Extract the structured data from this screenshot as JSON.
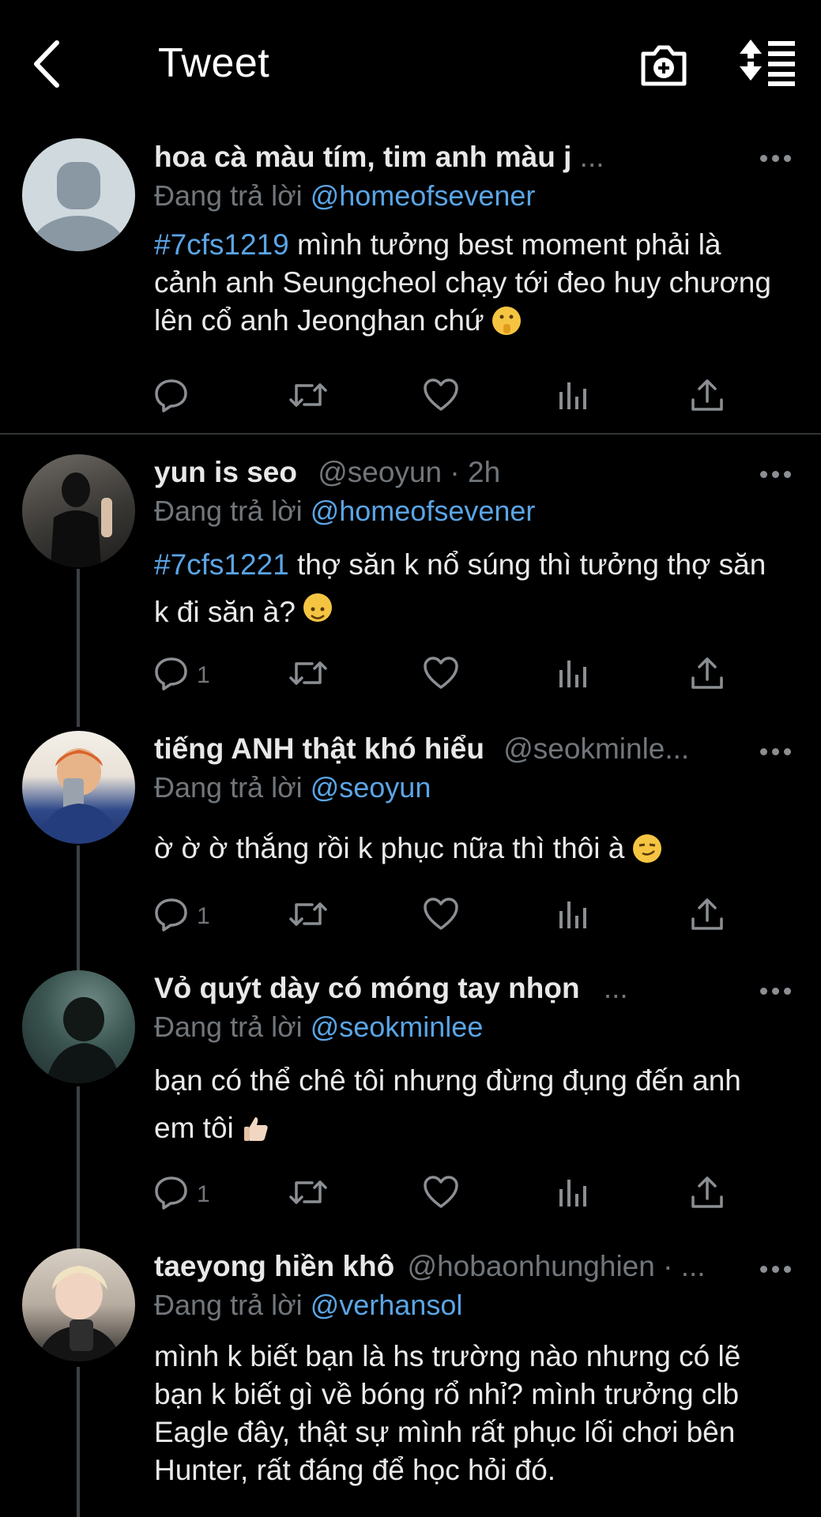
{
  "header": {
    "title": "Tweet"
  },
  "tweets": [
    {
      "name": "hoa cà màu tím, tim anh màu j",
      "handle": "",
      "ellipsis": "...",
      "reply_prefix": "Đang trả lời",
      "reply_to": "@homeofsevener",
      "hashtag": "#7cfs1219",
      "text": " mình tưởng best moment phải là cảnh anh Seungcheol chạy tới đeo huy chương lên cổ anh Jeonghan chứ",
      "emoji": "shushing-face",
      "reply_count": ""
    },
    {
      "name": "yun is seo",
      "handle": "@seoyun · 2h",
      "ellipsis": "",
      "reply_prefix": "Đang trả lời",
      "reply_to": "@homeofsevener",
      "hashtag": "#7cfs1221",
      "text": " thợ săn k nổ súng thì tưởng thợ săn k đi săn à?",
      "emoji": "slightly-smiling-face",
      "reply_count": "1"
    },
    {
      "name": "tiếng ANH thật khó hiểu",
      "handle": "@seokminle...",
      "ellipsis": "",
      "reply_prefix": "Đang trả lời",
      "reply_to": "@seoyun",
      "hashtag": "",
      "text": "ờ ờ ờ thắng rồi k phục nữa thì thôi à",
      "emoji": "smirking-face",
      "reply_count": "1"
    },
    {
      "name": "Vỏ quýt dày có móng tay nhọn",
      "handle": "",
      "ellipsis": "...",
      "reply_prefix": "Đang trả lời",
      "reply_to": "@seokminlee",
      "hashtag": "",
      "text": "bạn có thể chê tôi nhưng đừng đụng đến anh em tôi",
      "emoji": "thumbs-up",
      "reply_count": "1"
    },
    {
      "name": "taeyong hiền khô",
      "handle": "@hobaonhunghien · ...",
      "ellipsis": "",
      "reply_prefix": "Đang trả lời",
      "reply_to": "@verhansol",
      "hashtag": "",
      "text": "mình k biết bạn là hs trường nào nhưng có lẽ bạn k biết gì về bóng rổ nhỉ? mình trưởng clb Eagle đây, thật sự mình rất phục lối chơi bên Hunter, rất đáng để học hỏi đó.",
      "emoji": "",
      "reply_count": ""
    }
  ],
  "icons": {
    "back": "chevron-left-icon",
    "camera": "camera-plus-icon",
    "sort": "sort-replies-icon",
    "reply": "reply-bubble-icon",
    "retweet": "retweet-icon",
    "like": "heart-icon",
    "views": "analytics-icon",
    "share": "share-icon",
    "more": "more-dots-icon"
  },
  "colors": {
    "background": "#000000",
    "accent": "#1d9bf0",
    "muted": "#71767b",
    "text": "#e7e9ea"
  }
}
